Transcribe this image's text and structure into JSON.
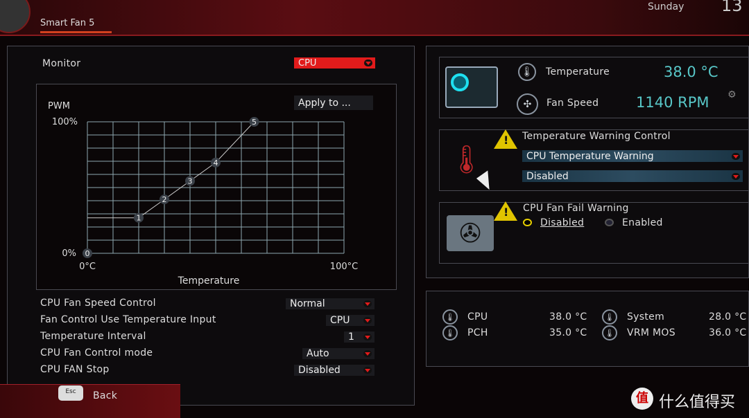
{
  "header": {
    "tab": "Smart Fan 5",
    "day": "Sunday",
    "date": "13"
  },
  "left": {
    "monitor_label": "Monitor",
    "monitor_value": "CPU",
    "apply_button": "Apply to ...",
    "settings": [
      {
        "label": "CPU Fan Speed Control",
        "value": "Normal"
      },
      {
        "label": "Fan Control Use Temperature Input",
        "value": "CPU"
      },
      {
        "label": "Temperature Interval",
        "value": "1"
      },
      {
        "label": "CPU Fan Control mode",
        "value": "Auto"
      },
      {
        "label": "CPU FAN Stop",
        "value": "Disabled"
      }
    ],
    "back_key": "Esc",
    "back_label": "Back"
  },
  "chart_data": {
    "type": "line",
    "ylabel": "PWM",
    "xlabel": "Temperature",
    "x_tick_labels": [
      "0°C",
      "100°C"
    ],
    "y_tick_labels": [
      "0%",
      "100%"
    ],
    "xlim": [
      0,
      100
    ],
    "ylim": [
      0,
      100
    ],
    "grid": true,
    "grid_divisions": 10,
    "points": [
      {
        "label": "0",
        "x": 0,
        "y": 0
      },
      {
        "label": "1",
        "x": 20,
        "y": 27
      },
      {
        "label": "2",
        "x": 30,
        "y": 41
      },
      {
        "label": "3",
        "x": 40,
        "y": 55
      },
      {
        "label": "4",
        "x": 50,
        "y": 69
      },
      {
        "label": "5",
        "x": 65,
        "y": 100
      }
    ]
  },
  "status": {
    "temp_label": "Temperature",
    "temp_value": "38.0 °C",
    "fan_label": "Fan Speed",
    "fan_value": "1140 RPM"
  },
  "temp_warning": {
    "title": "Temperature Warning Control",
    "source": "CPU Temperature Warning",
    "value": "Disabled"
  },
  "fan_fail": {
    "title": "CPU Fan Fail Warning",
    "options": [
      "Disabled",
      "Enabled"
    ],
    "selected": "Disabled"
  },
  "sensors": [
    {
      "name": "CPU",
      "value": "38.0 °C"
    },
    {
      "name": "System",
      "value": "28.0 °C"
    },
    {
      "name": "PCH",
      "value": "35.0 °C"
    },
    {
      "name": "VRM MOS",
      "value": "36.0 °C"
    }
  ],
  "watermark": "什么值得买",
  "colors": {
    "accent": "#e21b1b",
    "value": "#58c7c8",
    "warning": "#e0c400"
  }
}
